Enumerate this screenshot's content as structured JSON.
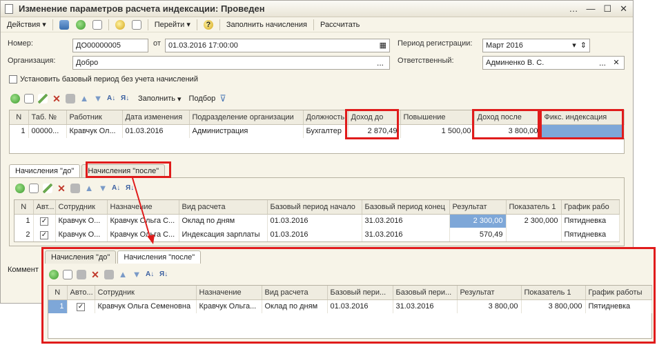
{
  "window": {
    "title": "Изменение параметров расчета индексации: Проведен"
  },
  "toolbar": {
    "actions": "Действия",
    "goto": "Перейти",
    "fill_accruals": "Заполнить начисления",
    "calculate": "Рассчитать"
  },
  "form": {
    "number_label": "Номер:",
    "number_value": "ДО00000005",
    "from_label": "от",
    "date_value": "01.03.2016 17:00:00",
    "period_label": "Период регистрации:",
    "period_value": "Март 2016",
    "org_label": "Организация:",
    "org_value": "Добро",
    "responsible_label": "Ответственный:",
    "responsible_value": "Админенко В. С.",
    "base_period_check": "Установить базовый период без учета начислений"
  },
  "table_toolbar": {
    "fill": "Заполнить",
    "pick": "Подбор"
  },
  "main_table": {
    "columns": [
      "N",
      "Таб. №",
      "Работник",
      "Дата изменения",
      "Подразделение организации",
      "Должность",
      "Доход до",
      "Повышение",
      "Доход после",
      "Фикс. индексация"
    ],
    "rows": [
      [
        "1",
        "00000...",
        "Кравчук Ол...",
        "01.03.2016",
        "Администрация",
        "Бухгалтер",
        "2 870,49",
        "1 500,00",
        "3 800,00",
        ""
      ]
    ]
  },
  "tabs": {
    "before": "Начисления \"до\"",
    "after": "Начисления \"после\""
  },
  "before_table": {
    "columns": [
      "N",
      "Авт...",
      "Сотрудник",
      "Назначение",
      "Вид расчета",
      "Базовый период начало",
      "Базовый период конец",
      "Результат",
      "Показатель 1",
      "График рабо"
    ],
    "rows": [
      [
        "1",
        "✓",
        "Кравчук О...",
        "Кравчук Ольга С...",
        "Оклад по дням",
        "01.03.2016",
        "31.03.2016",
        "2 300,00",
        "2 300,000",
        "Пятидневка"
      ],
      [
        "2",
        "✓",
        "Кравчук О...",
        "Кравчук Ольга С...",
        "Индексация зарплаты",
        "01.03.2016",
        "31.03.2016",
        "570,49",
        "",
        "Пятидневка"
      ]
    ]
  },
  "comment_label": "Коммент",
  "after_table": {
    "columns": [
      "N",
      "Авто...",
      "Сотрудник",
      "Назначение",
      "Вид расчета",
      "Базовый пери...",
      "Базовый пери...",
      "Результат",
      "Показатель 1",
      "График работы"
    ],
    "rows": [
      [
        "1",
        "✓",
        "Кравчук Ольга Семеновна",
        "Кравчук Ольга...",
        "Оклад по дням",
        "01.03.2016",
        "31.03.2016",
        "3 800,00",
        "3 800,000",
        "Пятидневка"
      ]
    ]
  }
}
